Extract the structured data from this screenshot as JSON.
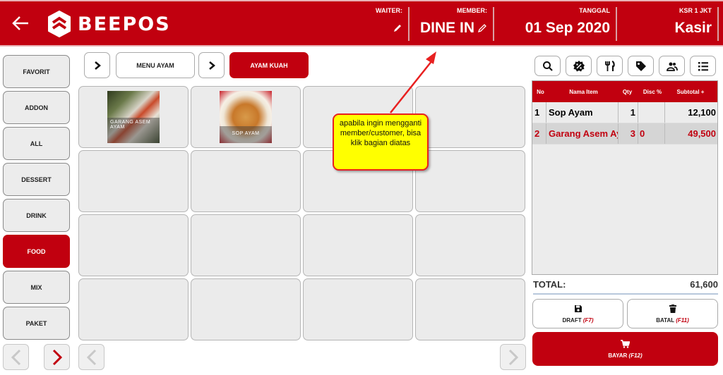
{
  "header": {
    "brand": "BEEPOS",
    "waiter_label": "WAITER:",
    "waiter_value": "",
    "member_label": "MEMBER:",
    "member_value": "DINE IN",
    "date_label": "TANGGAL",
    "date_value": "01 Sep 2020",
    "cashier_label": "KSR 1 JKT",
    "cashier_value": "Kasir",
    "accent": "#c1000f"
  },
  "categories": [
    {
      "label": "FAVORIT"
    },
    {
      "label": "ADDON"
    },
    {
      "label": "ALL"
    },
    {
      "label": "DESSERT"
    },
    {
      "label": "DRINK"
    },
    {
      "label": "FOOD",
      "active": true
    },
    {
      "label": "MIX"
    },
    {
      "label": "PAKET"
    }
  ],
  "breadcrumb": [
    {
      "label": "MENU AYAM"
    },
    {
      "label": "AYAM KUAH",
      "active": true
    }
  ],
  "products": [
    {
      "name": "GARANG ASEM AYAM"
    },
    {
      "name": "SOP AYAM"
    }
  ],
  "toolbar": [
    "search-icon",
    "discount-icon",
    "utensils-icon",
    "tag-icon",
    "customers-icon",
    "list-icon"
  ],
  "order_table": {
    "columns": [
      "No",
      "Nama Item",
      "Qty",
      "Disc %",
      "Subtotal +"
    ],
    "rows": [
      {
        "no": "1",
        "item": "Sop Ayam",
        "qty": "1",
        "disc": "",
        "subtotal": "12,100"
      },
      {
        "no": "2",
        "item": "Garang Asem Ayam",
        "qty": "3",
        "disc": "0",
        "subtotal": "49,500",
        "selected": true
      }
    ]
  },
  "total": {
    "label": "TOTAL:",
    "value": "61,600"
  },
  "actions": {
    "draft_label": "DRAFT",
    "draft_key": "(F7)",
    "cancel_label": "BATAL",
    "cancel_key": "(F11)",
    "pay_label": "BAYAR",
    "pay_key": "(F12)"
  },
  "callout": {
    "text": "apabila ingin mengganti member/customer, bisa klik bagian diatas"
  }
}
